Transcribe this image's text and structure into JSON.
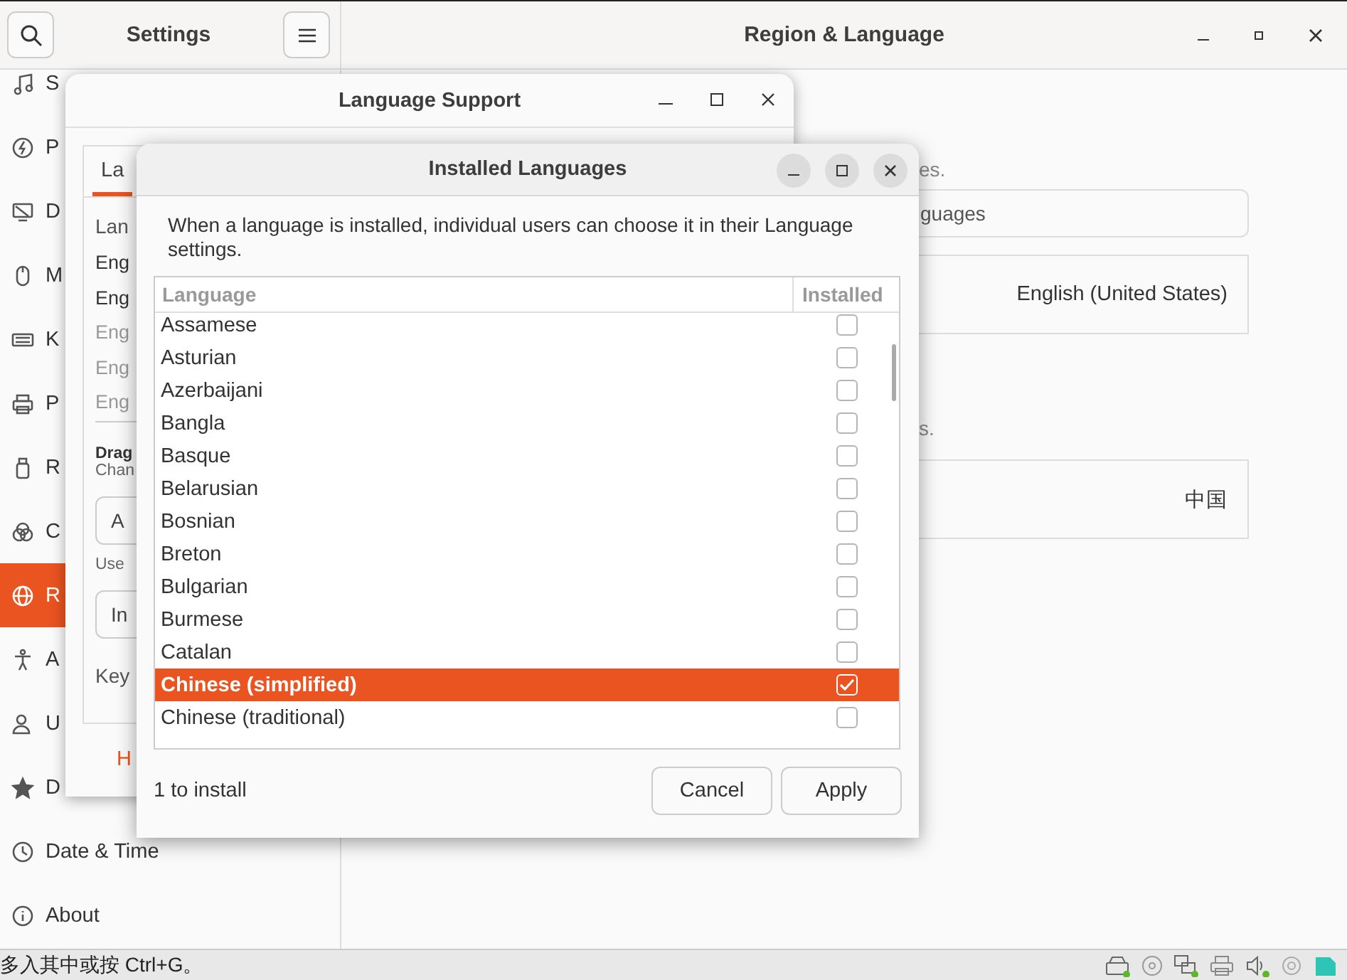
{
  "settings": {
    "title": "Settings",
    "page_title": "Region & Language",
    "sidebar": [
      {
        "label": "S",
        "selected": false
      },
      {
        "label": "P",
        "selected": false
      },
      {
        "label": "D",
        "selected": false
      },
      {
        "label": "M",
        "selected": false
      },
      {
        "label": "K",
        "selected": false
      },
      {
        "label": "P",
        "selected": false
      },
      {
        "label": "R",
        "selected": false
      },
      {
        "label": "C",
        "selected": false
      },
      {
        "label": "R",
        "selected": true
      },
      {
        "label": "A",
        "selected": false
      },
      {
        "label": "U",
        "selected": false
      },
      {
        "label": "D",
        "selected": false
      },
      {
        "label": "Date & Time",
        "selected": false
      },
      {
        "label": "About",
        "selected": false
      }
    ],
    "content": [
      {
        "kind": "note",
        "text": "es."
      },
      {
        "kind": "field",
        "text": "guages"
      },
      {
        "kind": "row",
        "text": "English (United States)"
      },
      {
        "kind": "note",
        "text": "s."
      },
      {
        "kind": "row",
        "text": "中国"
      }
    ]
  },
  "language_support": {
    "title": "Language Support",
    "tabs": [
      {
        "label": "La",
        "selected": true
      }
    ],
    "heading": "Lan",
    "languages": [
      {
        "label": "Eng",
        "disabled": false
      },
      {
        "label": "Eng",
        "disabled": false
      },
      {
        "label": "Eng",
        "disabled": true
      },
      {
        "label": "Eng",
        "disabled": true
      },
      {
        "label": "Eng",
        "disabled": true
      }
    ],
    "drag_title": "Drag",
    "drag_text": "Chan",
    "button_1": "A",
    "use_text": "Use",
    "button_2": "In",
    "keyboard_label": "Key",
    "help_button": "H"
  },
  "installed_languages": {
    "title": "Installed Languages",
    "description": "When a language is installed, individual users can choose it in their Language settings.",
    "columns": [
      "Language",
      "Installed"
    ],
    "rows": [
      {
        "name": "Assamese",
        "installed": false,
        "selected": false
      },
      {
        "name": "Asturian",
        "installed": false,
        "selected": false
      },
      {
        "name": "Azerbaijani",
        "installed": false,
        "selected": false
      },
      {
        "name": "Bangla",
        "installed": false,
        "selected": false
      },
      {
        "name": "Basque",
        "installed": false,
        "selected": false
      },
      {
        "name": "Belarusian",
        "installed": false,
        "selected": false
      },
      {
        "name": "Bosnian",
        "installed": false,
        "selected": false
      },
      {
        "name": "Breton",
        "installed": false,
        "selected": false
      },
      {
        "name": "Bulgarian",
        "installed": false,
        "selected": false
      },
      {
        "name": "Burmese",
        "installed": false,
        "selected": false
      },
      {
        "name": "Catalan",
        "installed": false,
        "selected": false
      },
      {
        "name": "Chinese (simplified)",
        "installed": true,
        "selected": true
      },
      {
        "name": "Chinese (traditional)",
        "installed": false,
        "selected": false
      }
    ],
    "status": "1 to install",
    "buttons": [
      "Cancel",
      "Apply"
    ]
  },
  "taskbar": {
    "hint": "多入其中或按 Ctrl+G。"
  }
}
